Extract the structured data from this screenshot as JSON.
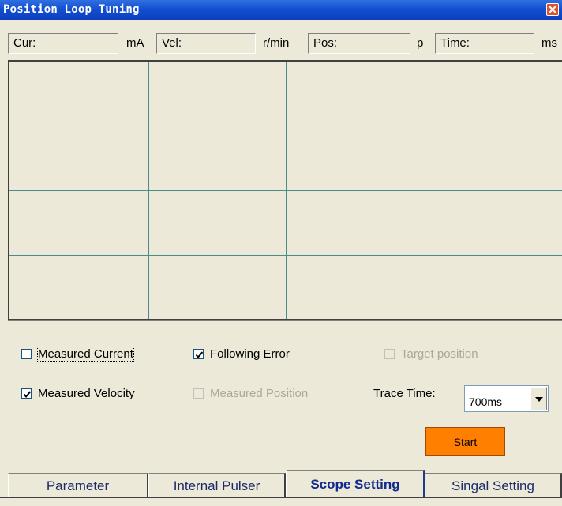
{
  "window": {
    "title": "Position Loop Tuning",
    "close_icon": "close-icon"
  },
  "readouts": [
    {
      "label": "Cur:",
      "unit": "mA"
    },
    {
      "label": "Vel:",
      "unit": "r/min"
    },
    {
      "label": "Pos:",
      "unit": "p"
    },
    {
      "label": "Time:",
      "unit": "ms"
    }
  ],
  "options": {
    "measured_current": {
      "label": "Measured Current",
      "checked": false,
      "enabled": true
    },
    "following_error": {
      "label": "Following Error",
      "checked": true,
      "enabled": true
    },
    "target_position": {
      "label": "Target position",
      "checked": false,
      "enabled": false
    },
    "measured_velocity": {
      "label": "Measured Velocity",
      "checked": true,
      "enabled": true
    },
    "measured_position": {
      "label": "Measured Position",
      "checked": false,
      "enabled": false
    }
  },
  "trace_time": {
    "label": "Trace Time:",
    "value": "700ms"
  },
  "start_button": {
    "label": "Start",
    "color": "#ff7f00"
  },
  "tabs": [
    {
      "label": "Parameter",
      "active": false
    },
    {
      "label": "Internal Pulser",
      "active": false
    },
    {
      "label": "Scope Setting",
      "active": true
    },
    {
      "label": "Singal Setting",
      "active": false
    }
  ],
  "colors": {
    "titlebar": "#1450d2",
    "grid_line": "#4a8c8c",
    "tab_text": "#0f2a8c"
  }
}
